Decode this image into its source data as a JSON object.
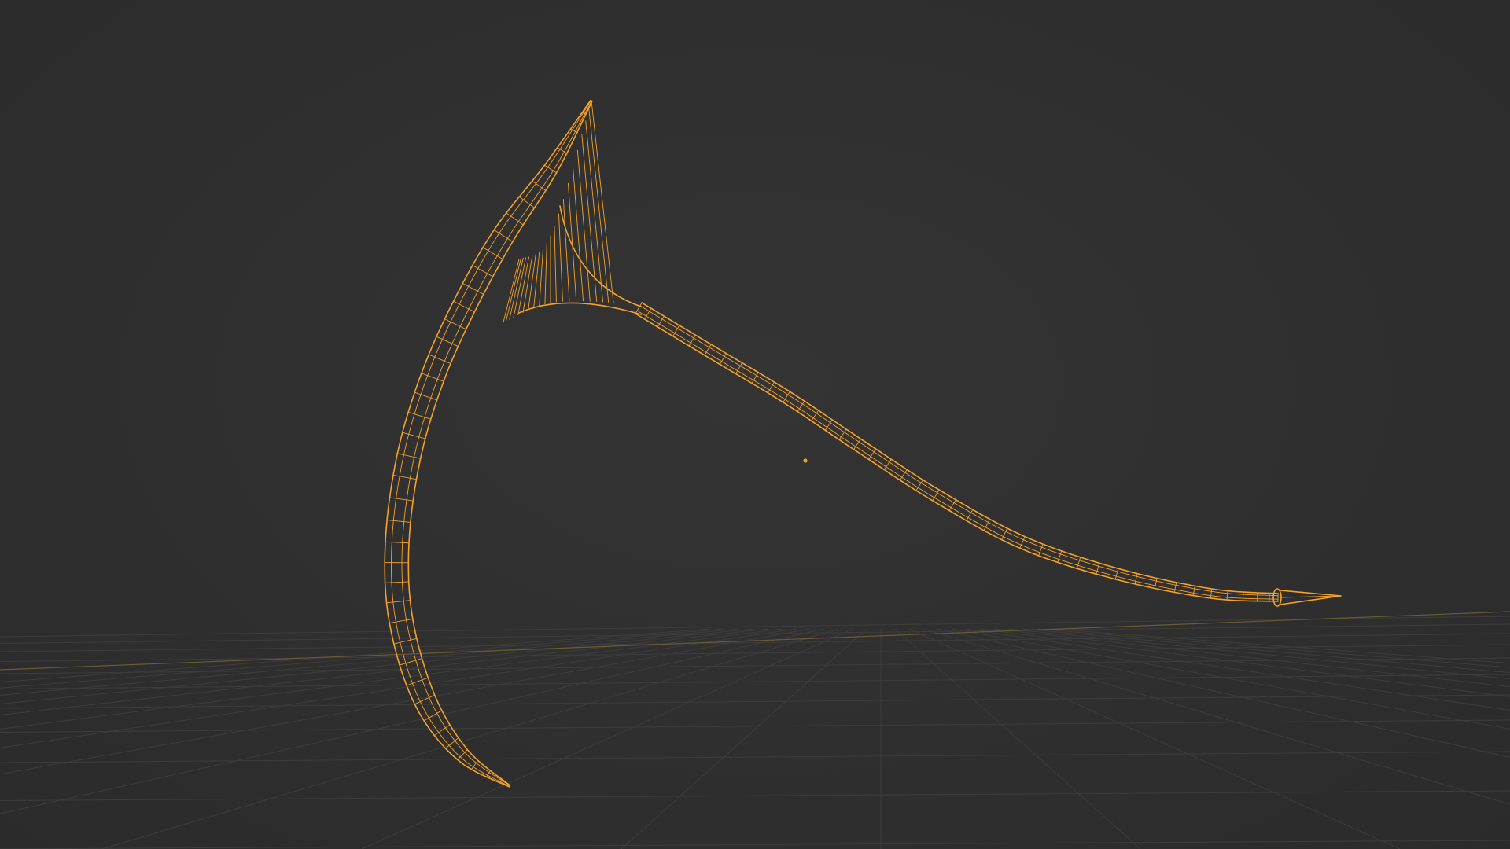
{
  "viewport": {
    "mode": "wireframe",
    "background_color": "#2f2f2f",
    "grid_color": "#3d3d3d",
    "x_axis_color": "#6b5a36",
    "selection_color": "#f5a12a",
    "origin_color": "#f5a12a"
  },
  "scene": {
    "object": "scythe",
    "object_icon": "mesh-wireframe",
    "origin_marker": "object-origin-dot",
    "selected": true
  }
}
